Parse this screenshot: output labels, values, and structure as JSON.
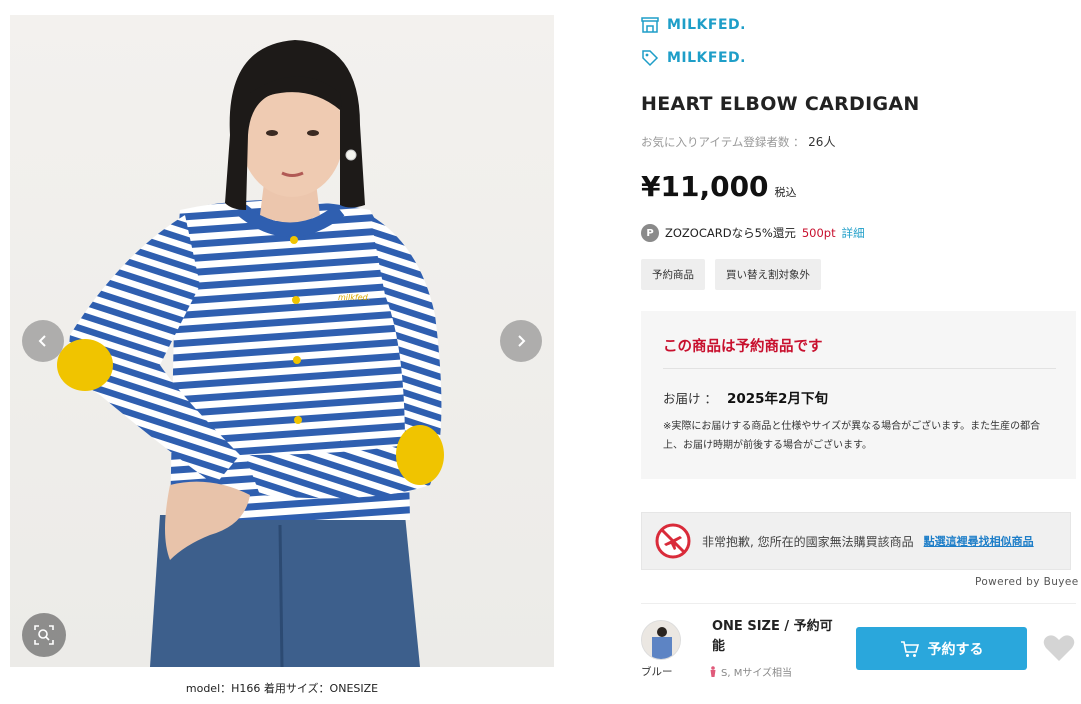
{
  "gallery": {
    "caption": "model：H166 着用サイズ：ONESIZE",
    "embroidery": "milkfed."
  },
  "brand": {
    "shop_name": "MILKFED.",
    "brand_name": "MILKFED."
  },
  "product": {
    "title": "HEART ELBOW CARDIGAN",
    "favorites_label": "お気に入りアイテム登録者数 ：",
    "favorites_count": "26人",
    "price": "¥11,000",
    "tax_label": "税込"
  },
  "zozocard": {
    "badge": "P",
    "text": "ZOZOCARDなら5%還元",
    "points": "500pt",
    "detail_link": "詳細"
  },
  "tags": [
    "予約商品",
    "買い替え割対象外"
  ],
  "preorder": {
    "heading": "この商品は予約商品です",
    "delivery_label": "お届け ：",
    "delivery_date": "2025年2月下旬",
    "note": "※実際にお届けする商品と仕様やサイズが異なる場合がございます。また生産の都合上、お届け時期が前後する場合がございます。"
  },
  "buyee": {
    "message": "非常抱歉, 您所在的國家無法購買該商品",
    "link": "點選這裡尋找相似商品",
    "powered": "Powered by Buyee"
  },
  "variant": {
    "color_label": "ブルー",
    "size_title": "ONE SIZE / 予約可能",
    "size_note": "S, Mサイズ相当",
    "buy_button": "予約する"
  },
  "colors": {
    "accent": "#2aa7dc",
    "brand_link": "#1e9ec8",
    "alert_red": "#c8102e",
    "stripe_blue": "#2f5fb0",
    "elbow_patch": "#f0c400"
  }
}
